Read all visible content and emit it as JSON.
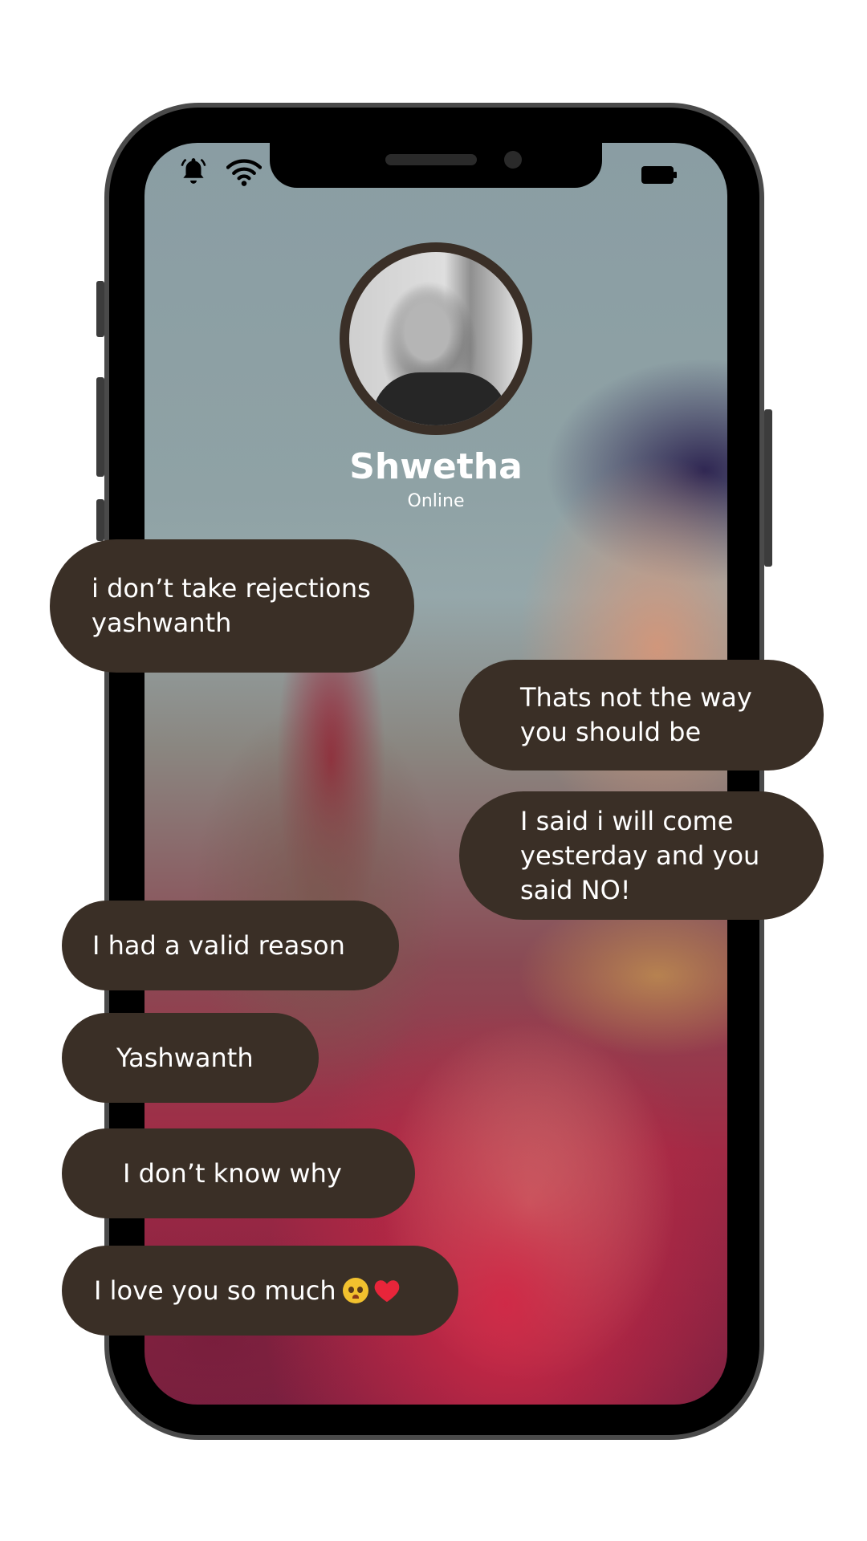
{
  "contact": {
    "name": "Shwetha",
    "status": "Online"
  },
  "status_bar": {
    "icons": [
      "bell-icon",
      "wifi-icon",
      "battery-icon"
    ]
  },
  "messages": [
    {
      "id": "m1",
      "side": "left",
      "lines": [
        "i don’t take rejections",
        "yashwanth"
      ]
    },
    {
      "id": "m2",
      "side": "right",
      "lines": [
        "Thats not the way",
        "you should be"
      ]
    },
    {
      "id": "m3",
      "side": "right",
      "lines": [
        "I said i will come",
        "yesterday and you",
        "said NO!"
      ]
    },
    {
      "id": "m4",
      "side": "left",
      "lines": [
        "I had a valid reason"
      ]
    },
    {
      "id": "m5",
      "side": "left",
      "lines": [
        "Yashwanth"
      ]
    },
    {
      "id": "m6",
      "side": "left",
      "lines": [
        "I don’t know why"
      ]
    },
    {
      "id": "m7",
      "side": "left",
      "text": "I love you so much",
      "emojis": [
        "pleading-face-emoji",
        "red-heart-emoji"
      ]
    }
  ],
  "colors": {
    "bubble": "#3a2f26",
    "avatar_ring": "#3a2f26",
    "text": "#ffffff"
  }
}
